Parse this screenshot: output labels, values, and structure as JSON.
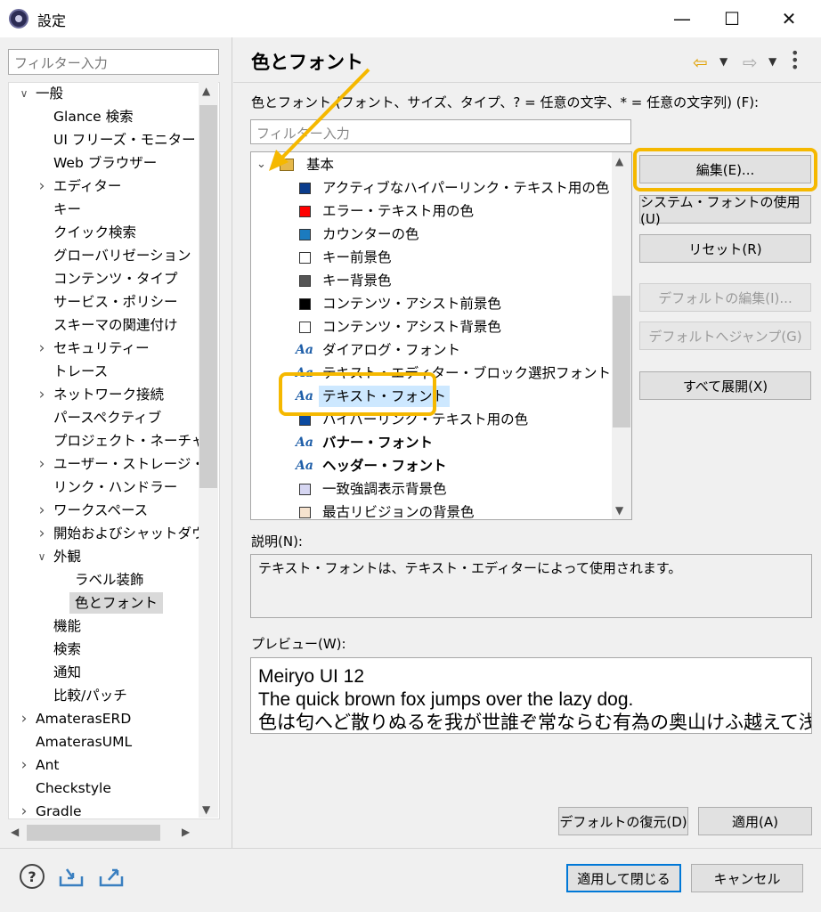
{
  "window": {
    "title": "設定",
    "minimize": "—",
    "maximize": "☐",
    "close": "✕"
  },
  "left": {
    "filter_placeholder": "フィルター入力",
    "tree": [
      {
        "label": "一般",
        "level": 0,
        "twisty": "expanded"
      },
      {
        "label": "Glance 検索",
        "level": 1
      },
      {
        "label": "UI フリーズ・モニター",
        "level": 1
      },
      {
        "label": "Web ブラウザー",
        "level": 1
      },
      {
        "label": "エディター",
        "level": 1,
        "twisty": "collapsed"
      },
      {
        "label": "キー",
        "level": 1
      },
      {
        "label": "クイック検索",
        "level": 1
      },
      {
        "label": "グローバリゼーション",
        "level": 1
      },
      {
        "label": "コンテンツ・タイプ",
        "level": 1
      },
      {
        "label": "サービス・ポリシー",
        "level": 1
      },
      {
        "label": "スキーマの関連付け",
        "level": 1
      },
      {
        "label": "セキュリティー",
        "level": 1,
        "twisty": "collapsed"
      },
      {
        "label": "トレース",
        "level": 1
      },
      {
        "label": "ネットワーク接続",
        "level": 1,
        "twisty": "collapsed"
      },
      {
        "label": "パースペクティブ",
        "level": 1
      },
      {
        "label": "プロジェクト・ネーチャー",
        "level": 1
      },
      {
        "label": "ユーザー・ストレージ・サー",
        "level": 1,
        "twisty": "collapsed"
      },
      {
        "label": "リンク・ハンドラー",
        "level": 1
      },
      {
        "label": "ワークスペース",
        "level": 1,
        "twisty": "collapsed"
      },
      {
        "label": "開始およびシャットダウン",
        "level": 1,
        "twisty": "collapsed"
      },
      {
        "label": "外観",
        "level": 1,
        "twisty": "expanded"
      },
      {
        "label": "ラベル装飾",
        "level": 2
      },
      {
        "label": "色とフォント",
        "level": 2,
        "selected": true
      },
      {
        "label": "機能",
        "level": 1
      },
      {
        "label": "検索",
        "level": 1
      },
      {
        "label": "通知",
        "level": 1
      },
      {
        "label": "比較/パッチ",
        "level": 1
      },
      {
        "label": "AmaterasERD",
        "level": 0,
        "twisty": "collapsed"
      },
      {
        "label": "AmaterasUML",
        "level": 0
      },
      {
        "label": "Ant",
        "level": 0,
        "twisty": "collapsed"
      },
      {
        "label": "Checkstyle",
        "level": 0
      },
      {
        "label": "Gradle",
        "level": 0,
        "twisty": "collapsed"
      }
    ]
  },
  "right": {
    "title": "色とフォント",
    "description": "色とフォント (フォント、サイズ、タイプ、? = 任意の文字、* = 任意の文字列) (F):",
    "filter_placeholder": "フィルター入力",
    "category": "基本",
    "items": [
      {
        "label": "アクティブなハイパーリンク・テキスト用の色",
        "kind": "color",
        "color": "#0b3c8c"
      },
      {
        "label": "エラー・テキスト用の色",
        "kind": "color",
        "color": "#ff0000"
      },
      {
        "label": "カウンターの色",
        "kind": "color",
        "color": "#1b7bbf"
      },
      {
        "label": "キー前景色",
        "kind": "color",
        "color": "#ffffff"
      },
      {
        "label": "キー背景色",
        "kind": "color",
        "color": "#555555"
      },
      {
        "label": "コンテンツ・アシスト前景色",
        "kind": "color",
        "color": "#000000"
      },
      {
        "label": "コンテンツ・アシスト背景色",
        "kind": "color",
        "color": "#ffffff"
      },
      {
        "label": "ダイアログ・フォント",
        "kind": "font"
      },
      {
        "label": "テキスト・エディター・ブロック選択フォント",
        "kind": "font"
      },
      {
        "label": "テキスト・フォント",
        "kind": "font",
        "selected": true
      },
      {
        "label": "ハイパーリンク・テキスト用の色",
        "kind": "color",
        "color": "#0b4aa0"
      },
      {
        "label": "バナー・フォント",
        "kind": "font",
        "bold": true
      },
      {
        "label": "ヘッダー・フォント",
        "kind": "font",
        "bold": true
      },
      {
        "label": "一致強調表示背景色",
        "kind": "color",
        "color": "#d6d6f2"
      },
      {
        "label": "最古リビジョンの背景色",
        "kind": "color",
        "color": "#f6e3cf"
      }
    ],
    "font_glyph": "Aa",
    "buttons": {
      "edit": "編集(E)...",
      "system_font": "システム・フォントの使用(U)",
      "reset": "リセット(R)",
      "edit_default": "デフォルトの編集(I)...",
      "goto_default": "デフォルトへジャンプ(G)",
      "expand_all": "すべて展開(X)"
    },
    "explanation_label": "説明(N):",
    "explanation": "テキスト・フォントは、テキスト・エディターによって使用されます。",
    "preview_label": "プレビュー(W):",
    "preview_lines": [
      "Meiryo UI 12",
      "The quick brown fox jumps over the lazy dog.",
      "色は匂へど散りぬるを我が世誰ぞ常ならむ有為の奥山けふ越えて浅き夢"
    ],
    "restore_defaults": "デフォルトの復元(D)",
    "apply": "適用(A)"
  },
  "footer": {
    "apply_close": "適用して閉じる",
    "cancel": "キャンセル"
  },
  "accent": {
    "highlight": "#f5b800",
    "focus": "#0078d7"
  }
}
